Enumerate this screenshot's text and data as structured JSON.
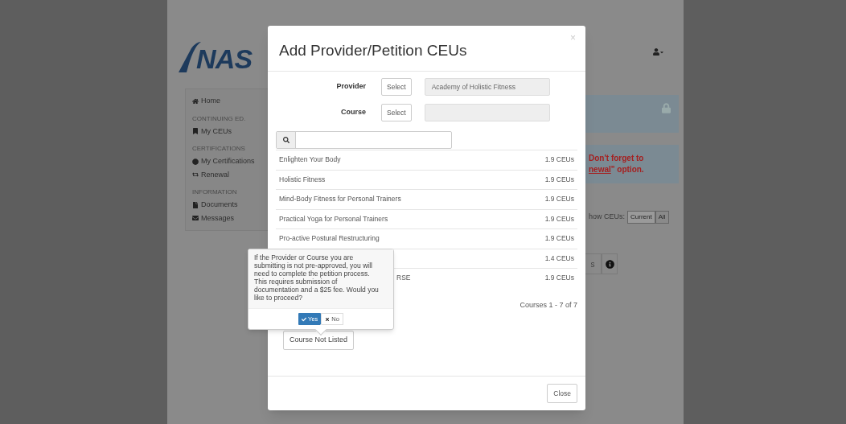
{
  "background_page": {
    "logo": "NAS",
    "sidebar": [
      {
        "kind": "item",
        "label": "Home"
      },
      {
        "kind": "heading",
        "label": "CONTINUING ED."
      },
      {
        "kind": "item",
        "label": "My CEUs"
      },
      {
        "kind": "heading",
        "label": "CERTIFICATIONS"
      },
      {
        "kind": "item",
        "label": "My Certifications"
      },
      {
        "kind": "item",
        "label": "Renewal"
      },
      {
        "kind": "heading",
        "label": "INFORMATION"
      },
      {
        "kind": "item",
        "label": "Documents"
      },
      {
        "kind": "item",
        "label": "Messages"
      }
    ],
    "notice": {
      "line1": "Don't forget to",
      "link": "newal",
      "line2": "\" option."
    },
    "show_ceus": {
      "label": "how CEUs:",
      "options": [
        {
          "label": "Current",
          "selected": true
        },
        {
          "label": "All",
          "selected": false
        }
      ]
    },
    "tab_fragment": "s"
  },
  "modal": {
    "title": "Add Provider/Petition CEUs",
    "close_glyph": "×",
    "fields": [
      {
        "label": "Provider",
        "button": "Select",
        "value": "Academy of Holistic Fitness"
      },
      {
        "label": "Course",
        "button": "Select"
      }
    ],
    "courses": [
      {
        "name": "Enlighten Your Body",
        "ceus": "1.9 CEUs"
      },
      {
        "name": "Holistic Fitness",
        "ceus": "1.9 CEUs"
      },
      {
        "name": "Mind-Body Fitness for Personal Trainers",
        "ceus": "1.9 CEUs"
      },
      {
        "name": "Practical Yoga for Personal Trainers",
        "ceus": "1.9 CEUs"
      },
      {
        "name": "Pro-active Postural Restructuring",
        "ceus": "1.9 CEUs"
      },
      {
        "kind": "covered",
        "ceus": "1.4 CEUs"
      },
      {
        "kind": "partly_covered",
        "name": "RSE",
        "ceus": "1.9 CEUs"
      }
    ],
    "pagination": "Courses 1 - 7 of 7",
    "not_listed_button": "Course Not Listed",
    "footer_button": "Close"
  },
  "popover": {
    "text": "If the Provider or Course you are submitting is not pre-approved, you will need to complete the petition process. This requires submission of documentation and a $25 fee. Would you like to proceed?",
    "yes": "Yes",
    "no": "No"
  }
}
